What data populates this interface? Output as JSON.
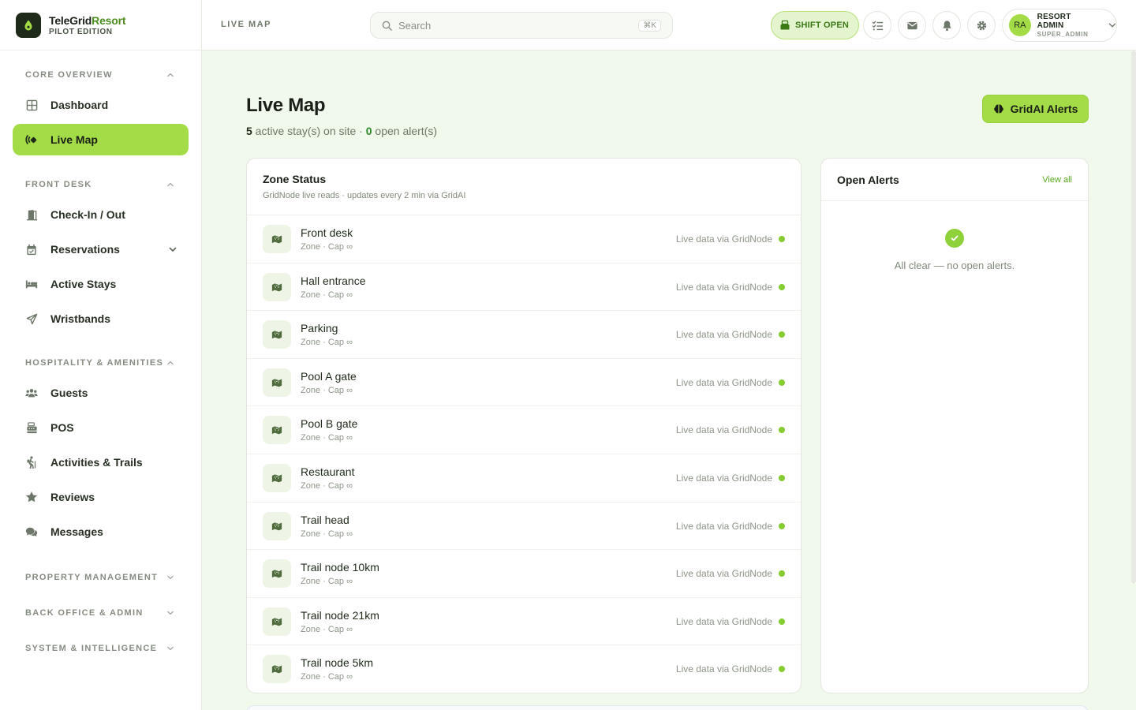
{
  "brand": {
    "name_part1": "TeleGrid",
    "name_part2": "Resort",
    "edition": "PILOT EDITION"
  },
  "sidebar": {
    "sections": [
      {
        "title": "CORE OVERVIEW",
        "items": [
          {
            "label": "Dashboard",
            "icon": "grid-icon"
          },
          {
            "label": "Live Map",
            "icon": "satellite-icon",
            "active": true
          }
        ]
      },
      {
        "title": "FRONT DESK",
        "items": [
          {
            "label": "Check-In / Out",
            "icon": "door-icon"
          },
          {
            "label": "Reservations",
            "icon": "calendar-icon"
          },
          {
            "label": "Active Stays",
            "icon": "bed-icon"
          },
          {
            "label": "Wristbands",
            "icon": "send-icon"
          }
        ]
      },
      {
        "title": "HOSPITALITY & AMENITIES",
        "items": [
          {
            "label": "Guests",
            "icon": "users-icon"
          },
          {
            "label": "POS",
            "icon": "cash-register-icon"
          },
          {
            "label": "Activities & Trails",
            "icon": "hiker-icon"
          },
          {
            "label": "Reviews",
            "icon": "star-icon"
          },
          {
            "label": "Messages",
            "icon": "chat-icon"
          }
        ]
      },
      {
        "title": "PROPERTY MANAGEMENT"
      },
      {
        "title": "BACK OFFICE & ADMIN"
      },
      {
        "title": "SYSTEM & INTELLIGENCE"
      }
    ]
  },
  "header": {
    "title": "LIVE MAP",
    "search_placeholder": "Search",
    "search_shortcut": "⌘K",
    "shift_label": "SHIFT OPEN",
    "user": {
      "initials": "RA",
      "name": "RESORT ADMIN",
      "role": "SUPER_ADMIN"
    }
  },
  "page": {
    "title": "Live Map",
    "active_stays": "5",
    "active_stays_text": " active stay(s) on site · ",
    "open_alerts": "0",
    "open_alerts_text": " open alert(s)",
    "ai_button": "GridAI Alerts"
  },
  "zone_status": {
    "title": "Zone Status",
    "subtitle": "GridNode live reads · updates every 2 min via GridAI",
    "status_text": "Live data via GridNode",
    "meta_text": "Zone · Cap ∞",
    "zones": [
      "Front desk",
      "Hall entrance",
      "Parking",
      "Pool A gate",
      "Pool B gate",
      "Restaurant",
      "Trail head",
      "Trail node 10km",
      "Trail node 21km",
      "Trail node 5km"
    ]
  },
  "alerts": {
    "title": "Open Alerts",
    "view_all": "View all",
    "empty_text": "All clear — no open alerts."
  },
  "colors": {
    "accent": "#a4dc48",
    "accent_dark": "#4d8d20",
    "status_dot": "#84cc2f",
    "background": "#f1f8ec"
  }
}
